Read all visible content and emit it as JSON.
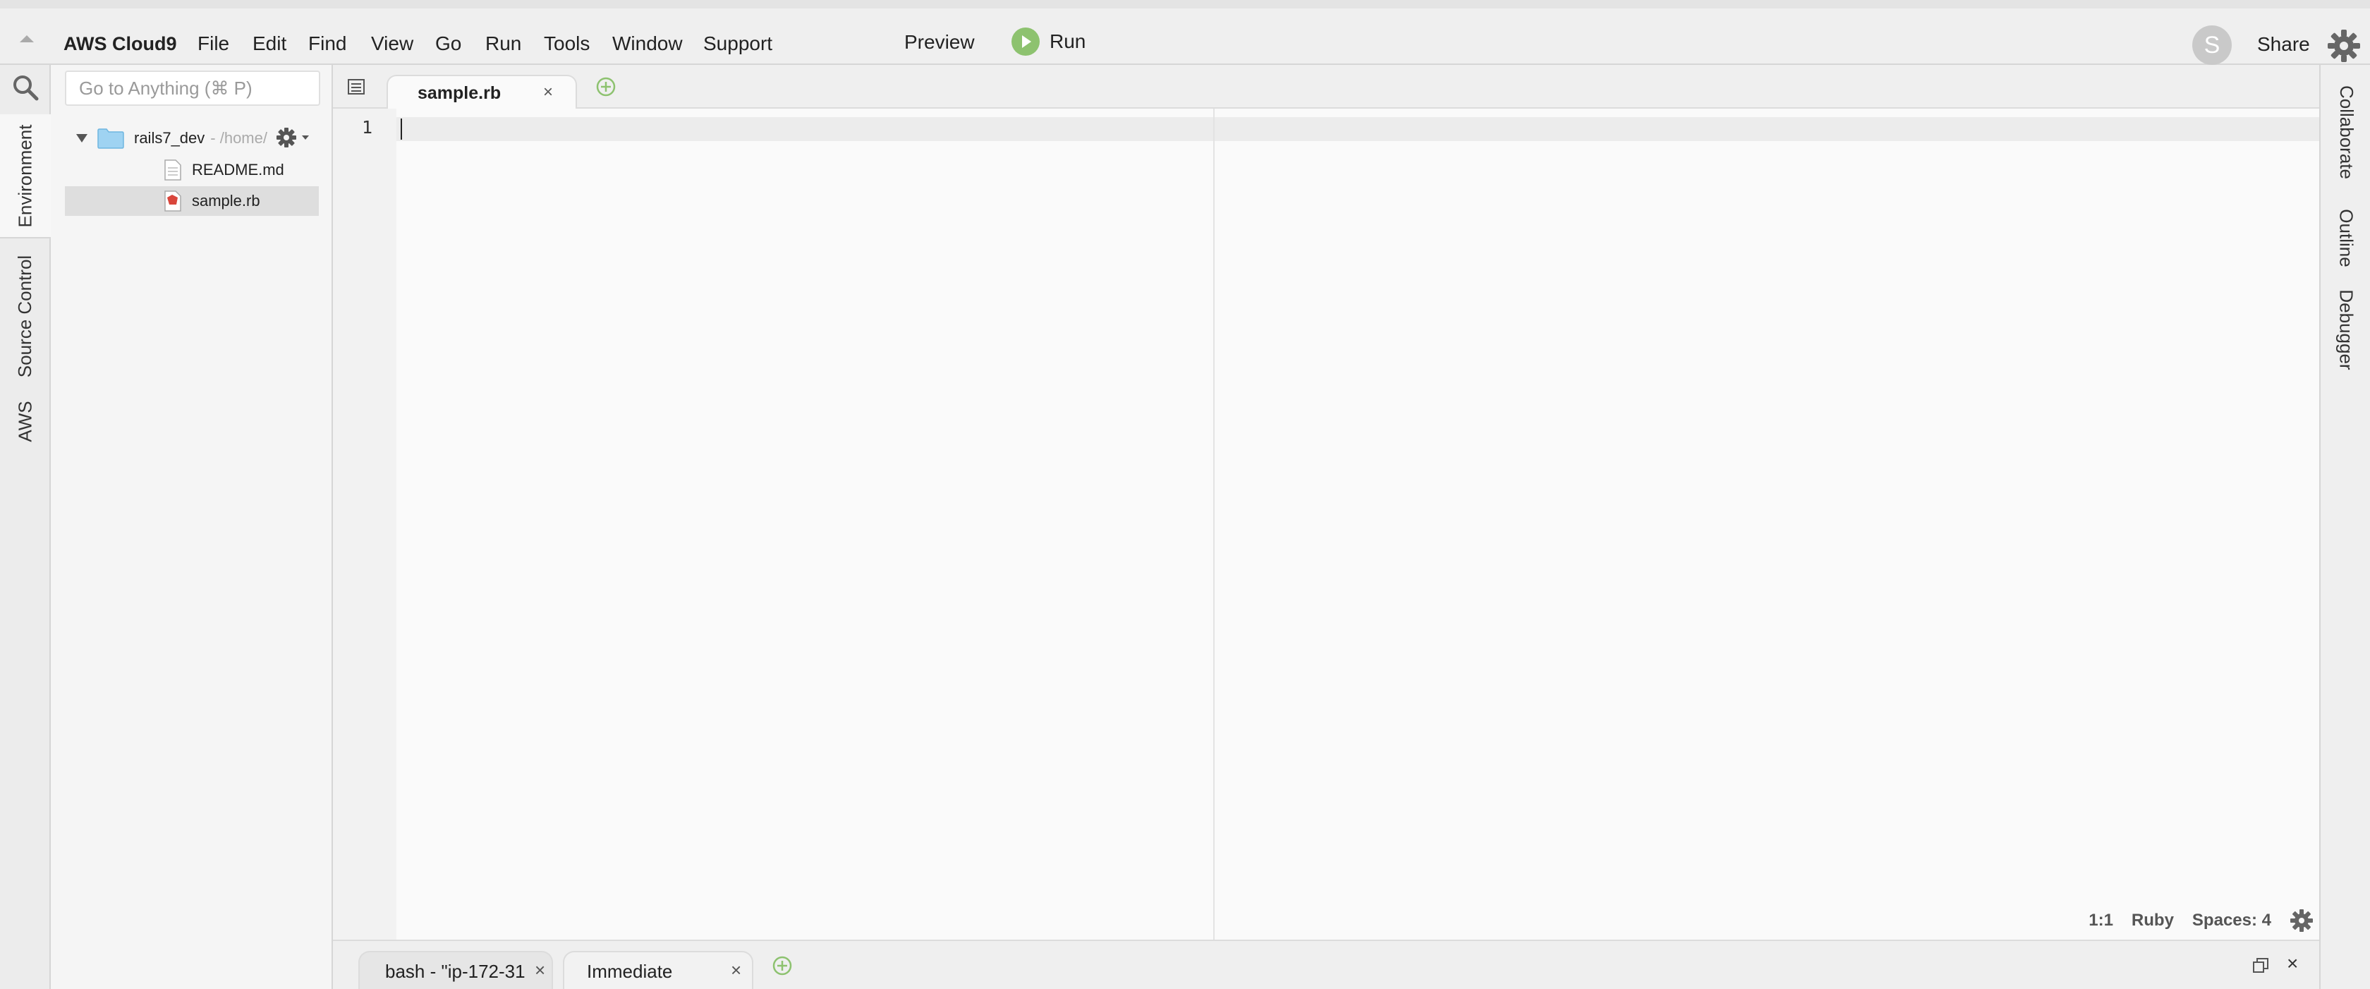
{
  "menubar": {
    "brand": "AWS Cloud9",
    "items": [
      "File",
      "Edit",
      "Find",
      "View",
      "Go",
      "Run",
      "Tools",
      "Window",
      "Support"
    ],
    "preview_label": "Preview",
    "run_label": "Run",
    "avatar_initial": "S",
    "share_label": "Share"
  },
  "left_rail": {
    "tabs": [
      "Environment",
      "Source Control",
      "AWS"
    ]
  },
  "file_tree": {
    "search_placeholder": "Go to Anything (⌘ P)",
    "root_name": "rails7_dev",
    "root_path": "- /home/",
    "files": [
      {
        "name": "README.md",
        "icon": "document-icon",
        "selected": false
      },
      {
        "name": "sample.rb",
        "icon": "ruby-file-icon",
        "selected": true
      }
    ]
  },
  "editor": {
    "tabs": [
      {
        "label": "sample.rb",
        "close": "×"
      }
    ],
    "line_numbers": [
      "1"
    ],
    "status": {
      "position": "1:1",
      "language": "Ruby",
      "indent": "Spaces: 4"
    }
  },
  "right_rail": {
    "tabs": [
      "Collaborate",
      "Outline",
      "Debugger"
    ]
  },
  "console": {
    "tabs": [
      {
        "label": "bash - \"ip-172-31",
        "close": "×"
      },
      {
        "label": "Immediate",
        "close": "×"
      }
    ],
    "close": "×"
  },
  "colors": {
    "run_green": "#8dc26f",
    "add_tab_green": "#8dc26f",
    "folder_blue": "#9fd3f2",
    "ruby_red": "#d9463c"
  }
}
